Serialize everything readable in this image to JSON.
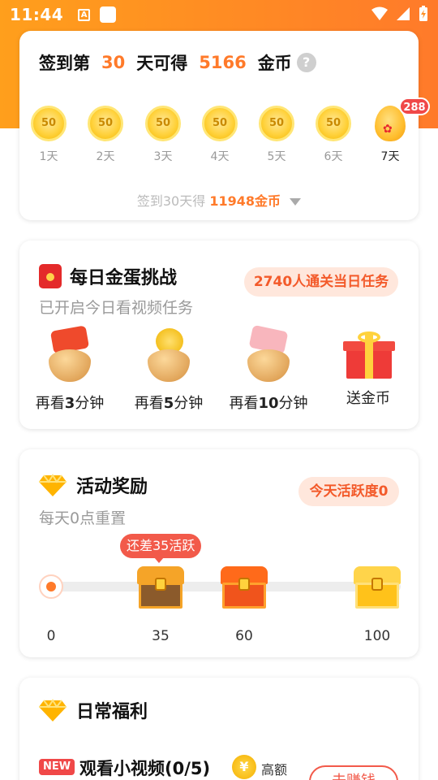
{
  "status_bar": {
    "time": "11:44",
    "icons": [
      "notification-a-icon",
      "square-notification-icon",
      "wifi-icon",
      "cellular-signal-icon",
      "battery-charging-icon"
    ],
    "notification_letter": "A"
  },
  "colors": {
    "header_orange": "#ff8f24",
    "accent_orange": "#ff7a2a",
    "accent_red": "#f25a4a",
    "pill_bg": "#ffe7dc"
  },
  "signin": {
    "title_prefix": "签到第",
    "day_count": "30",
    "title_mid": "天可得",
    "coin_total": "5166",
    "title_suffix": "金币",
    "help_glyph": "?",
    "days": [
      {
        "coin": "50",
        "label": "1天"
      },
      {
        "coin": "50",
        "label": "2天"
      },
      {
        "coin": "50",
        "label": "3天"
      },
      {
        "coin": "50",
        "label": "4天"
      },
      {
        "coin": "50",
        "label": "5天"
      },
      {
        "coin": "50",
        "label": "6天"
      },
      {
        "coin": "",
        "label": "7天",
        "badge": "288"
      }
    ],
    "footer_prefix": "签到30天得",
    "footer_amount": "11948金币"
  },
  "egg_challenge": {
    "title": "每日金蛋挑战",
    "pill": "2740人通关当日任务",
    "subtitle": "已开启今日看视频任务",
    "tasks": [
      {
        "pre": "再看",
        "num": "3",
        "post": "分钟"
      },
      {
        "pre": "再看",
        "num": "5",
        "post": "分钟"
      },
      {
        "pre": "再看",
        "num": "10",
        "post": "分钟"
      },
      {
        "pre": "送金币",
        "num": "",
        "post": ""
      }
    ]
  },
  "activity": {
    "title": "活动奖励",
    "pill_prefix": "今天活跃度",
    "pill_value": "0",
    "subtitle": "每天0点重置",
    "tooltip": "还差35活跃",
    "milestones": [
      "0",
      "35",
      "60",
      "100"
    ],
    "progress": 0
  },
  "daily": {
    "title": "日常福利",
    "new_badge": "NEW",
    "video_title": "观看小视频(0/5)",
    "yen_glyph": "¥",
    "high_label": "高额",
    "button_label": "去赚钱"
  }
}
